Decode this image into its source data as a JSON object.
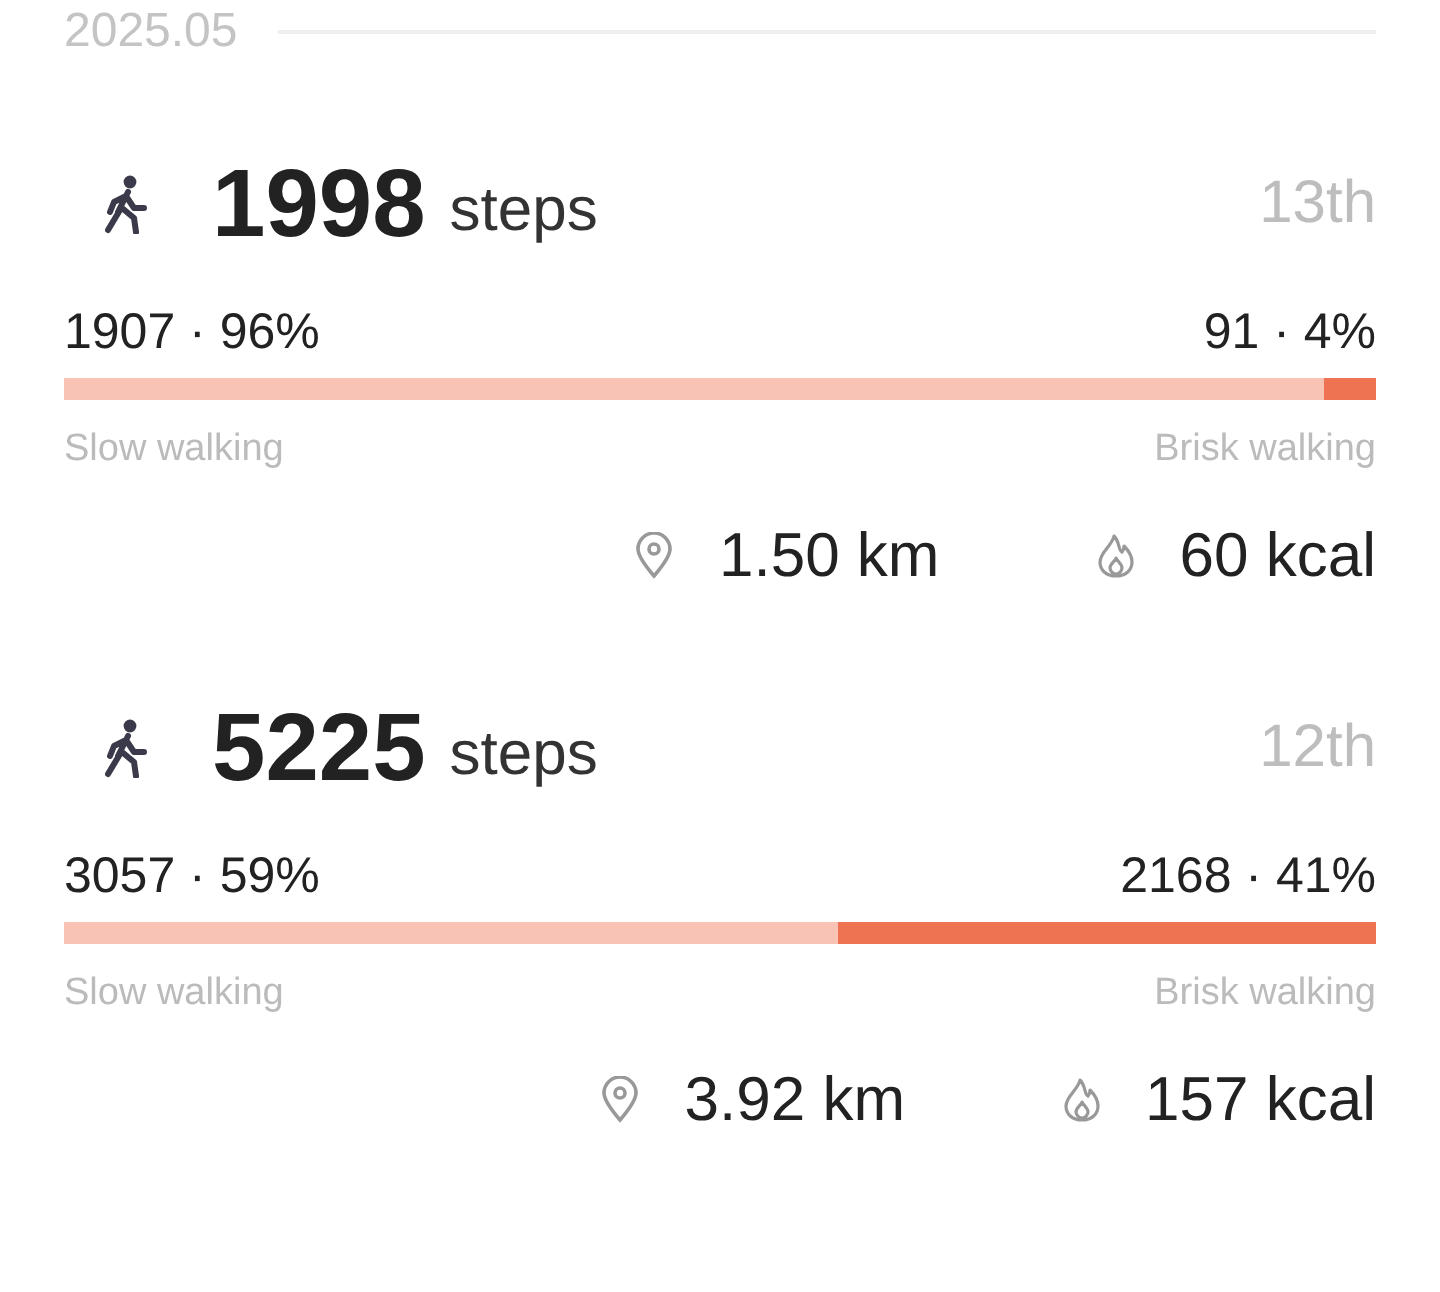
{
  "month": {
    "label": "2025.05"
  },
  "records": [
    {
      "steps": "1998",
      "unit": "steps",
      "day": "13th",
      "slow_stat": "1907 · 96%",
      "brisk_stat": "91 · 4%",
      "level": 0.04,
      "slow_label": "Slow walking",
      "brisk_label": "Brisk walking",
      "distance": "1.50 km",
      "calories": "60 kcal"
    },
    {
      "steps": "5225",
      "unit": "steps",
      "day": "12th",
      "slow_stat": "3057 · 59%",
      "brisk_stat": "2168 · 41%",
      "level": 0.41,
      "slow_label": "Slow walking",
      "brisk_label": "Brisk walking",
      "distance": "3.92 km",
      "calories": "157 kcal"
    }
  ]
}
